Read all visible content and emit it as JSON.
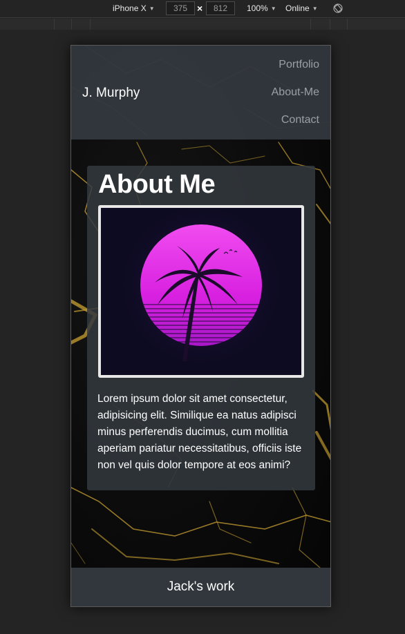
{
  "devtools": {
    "device": "iPhone X",
    "width": "375",
    "height": "812",
    "zoom": "100%",
    "network": "Online"
  },
  "navbar": {
    "brand": "J. Murphy",
    "links": [
      "Portfolio",
      "About-Me",
      "Contact"
    ]
  },
  "about": {
    "title": "About Me",
    "image": "palm-tree-sunset",
    "text": "Lorem ipsum dolor sit amet consectetur, adipisicing elit. Similique ea natus adipisci minus perferendis ducimus, cum mollitia aperiam pariatur necessitatibus, officiis iste non vel quis dolor tempore at eos animi?"
  },
  "footer": {
    "text": "Jack's work"
  },
  "colors": {
    "navbar": "#343a40",
    "sun": "#e030e8",
    "marble_veins": "#c8a030"
  }
}
